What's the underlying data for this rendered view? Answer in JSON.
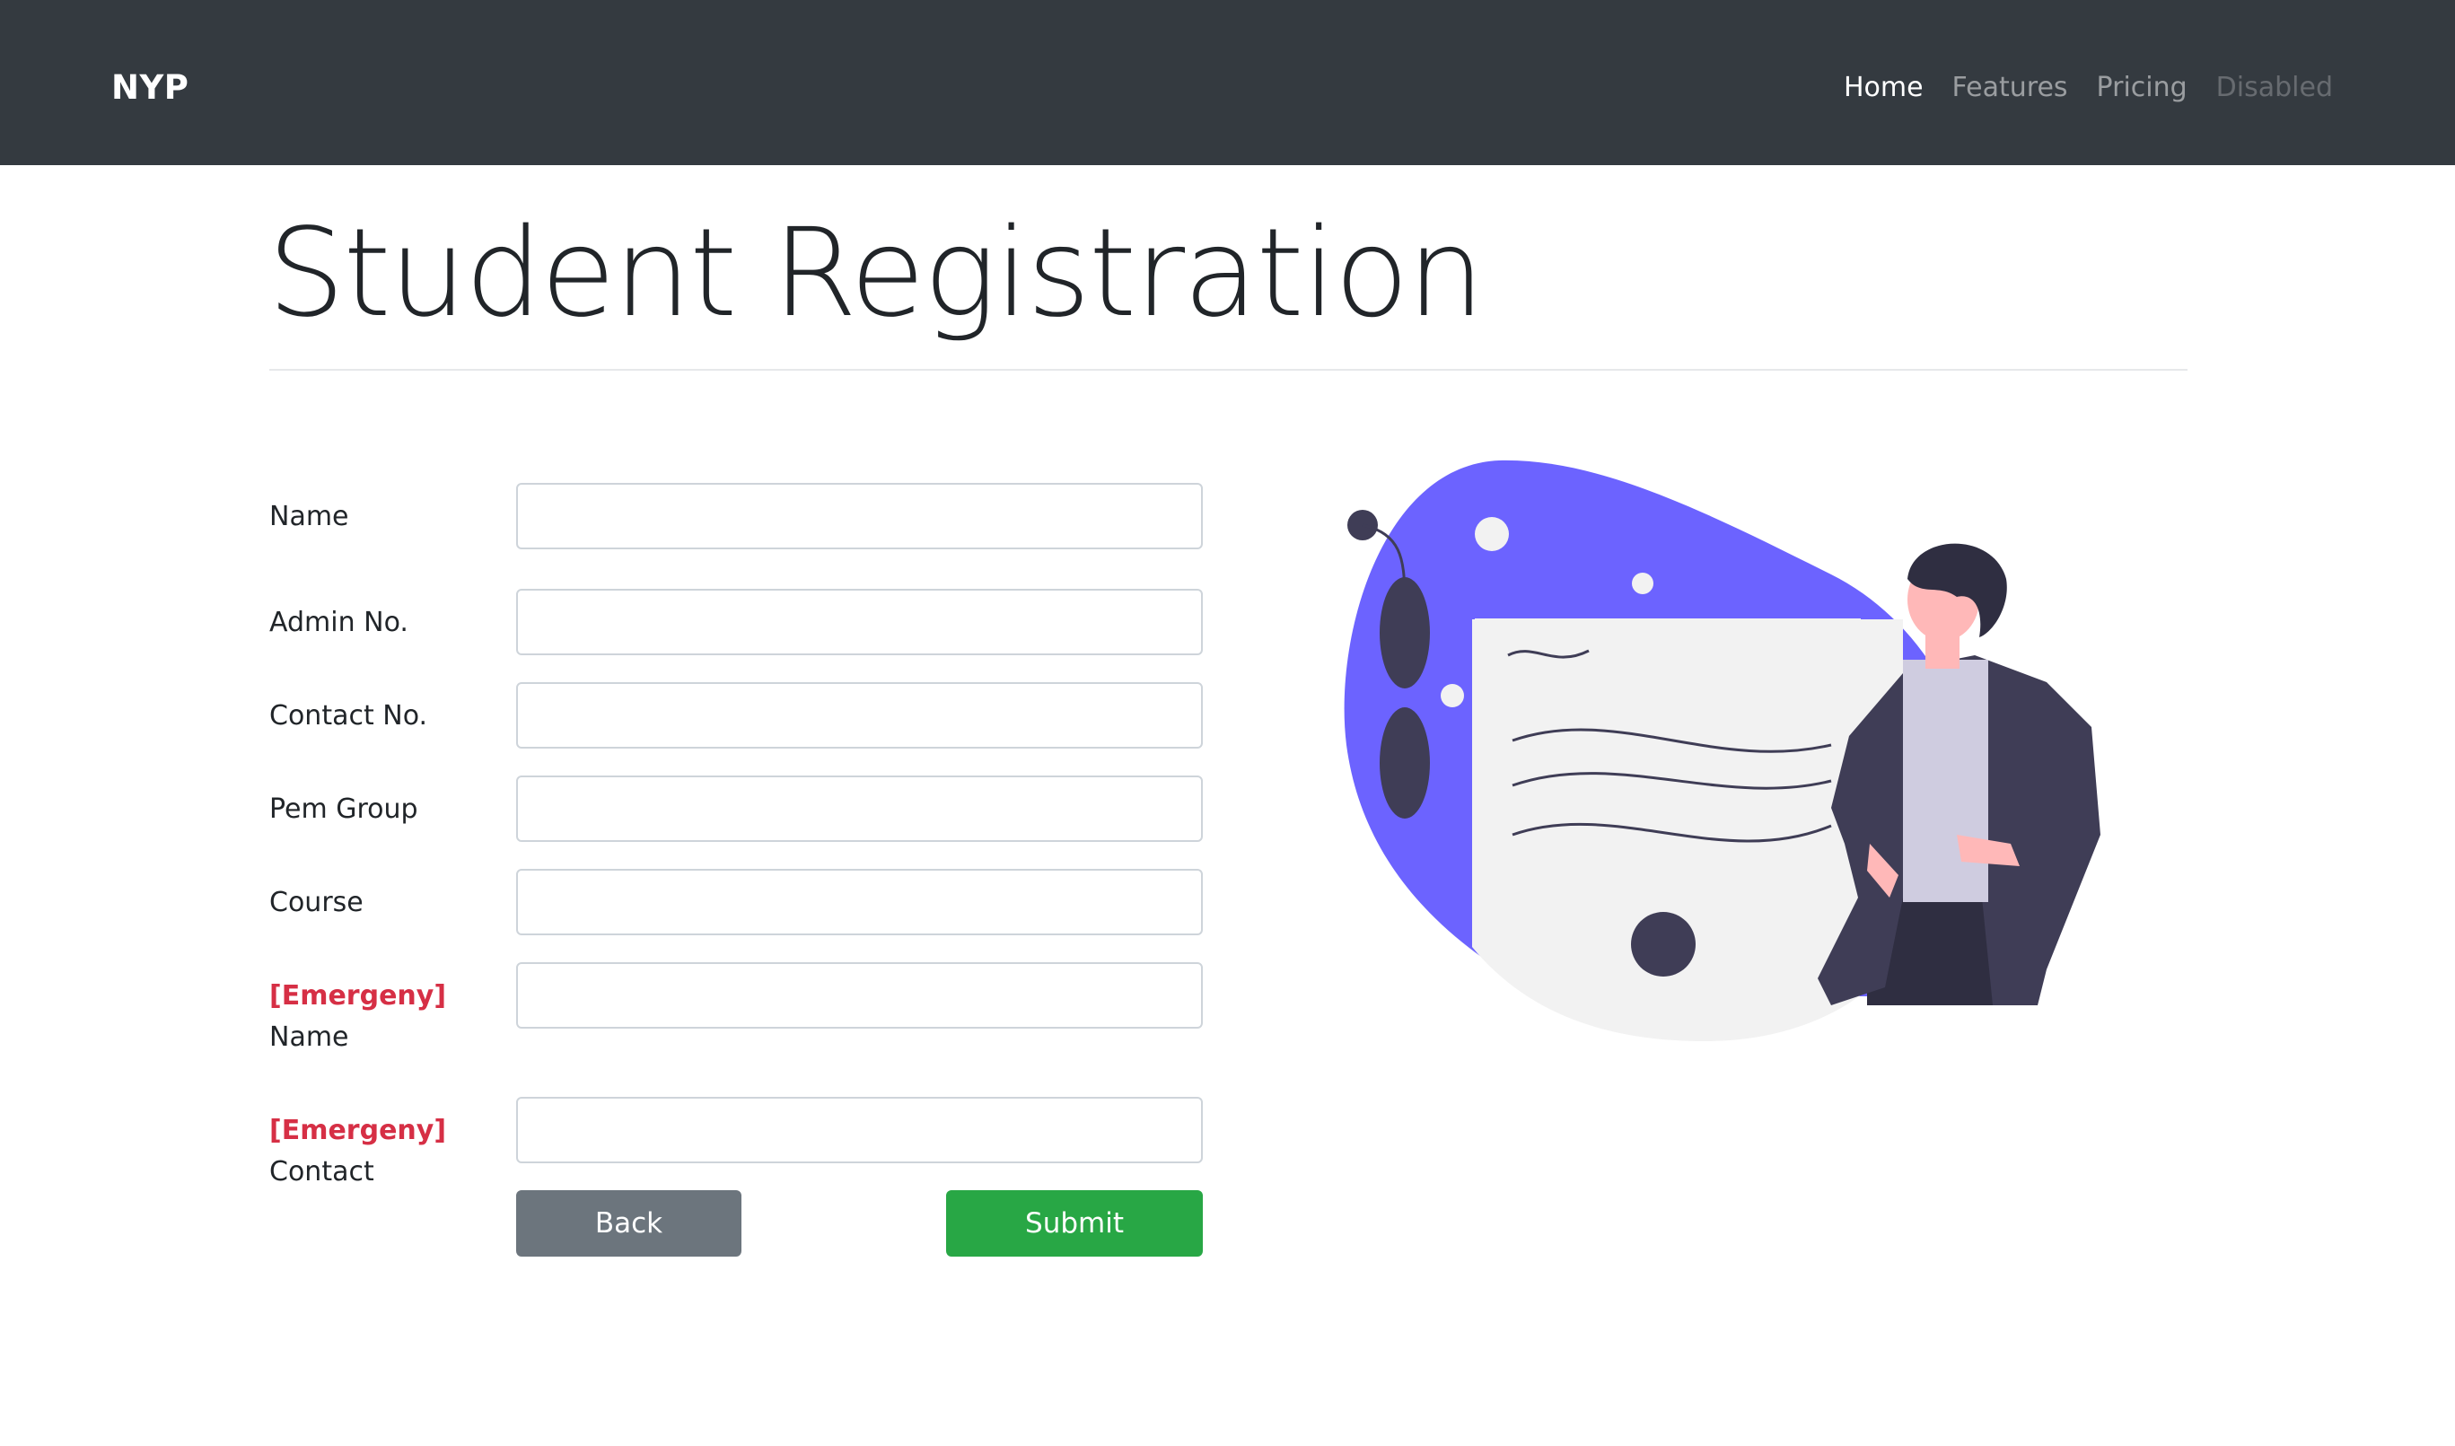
{
  "navbar": {
    "brand": "NYP",
    "links": [
      {
        "label": "Home",
        "state": "active"
      },
      {
        "label": "Features",
        "state": "normal"
      },
      {
        "label": "Pricing",
        "state": "normal"
      },
      {
        "label": "Disabled",
        "state": "disabled"
      }
    ]
  },
  "page": {
    "title": "Student Registration"
  },
  "form": {
    "fields": [
      {
        "label": "Name",
        "value": ""
      },
      {
        "label": "Admin No.",
        "value": ""
      },
      {
        "label": "Contact No.",
        "value": ""
      },
      {
        "label": "Pem Group",
        "value": ""
      },
      {
        "label": "Course",
        "value": ""
      },
      {
        "tag": "[Emergeny]",
        "label": "Name",
        "value": ""
      },
      {
        "tag": "[Emergeny]",
        "label": "Contact",
        "value": ""
      }
    ],
    "back_label": "Back",
    "submit_label": "Submit"
  },
  "colors": {
    "navbar_bg": "#343a40",
    "accent_blob": "#6c63ff",
    "required_red": "#d62f45",
    "submit_green": "#28a745",
    "back_gray": "#6c757d"
  }
}
